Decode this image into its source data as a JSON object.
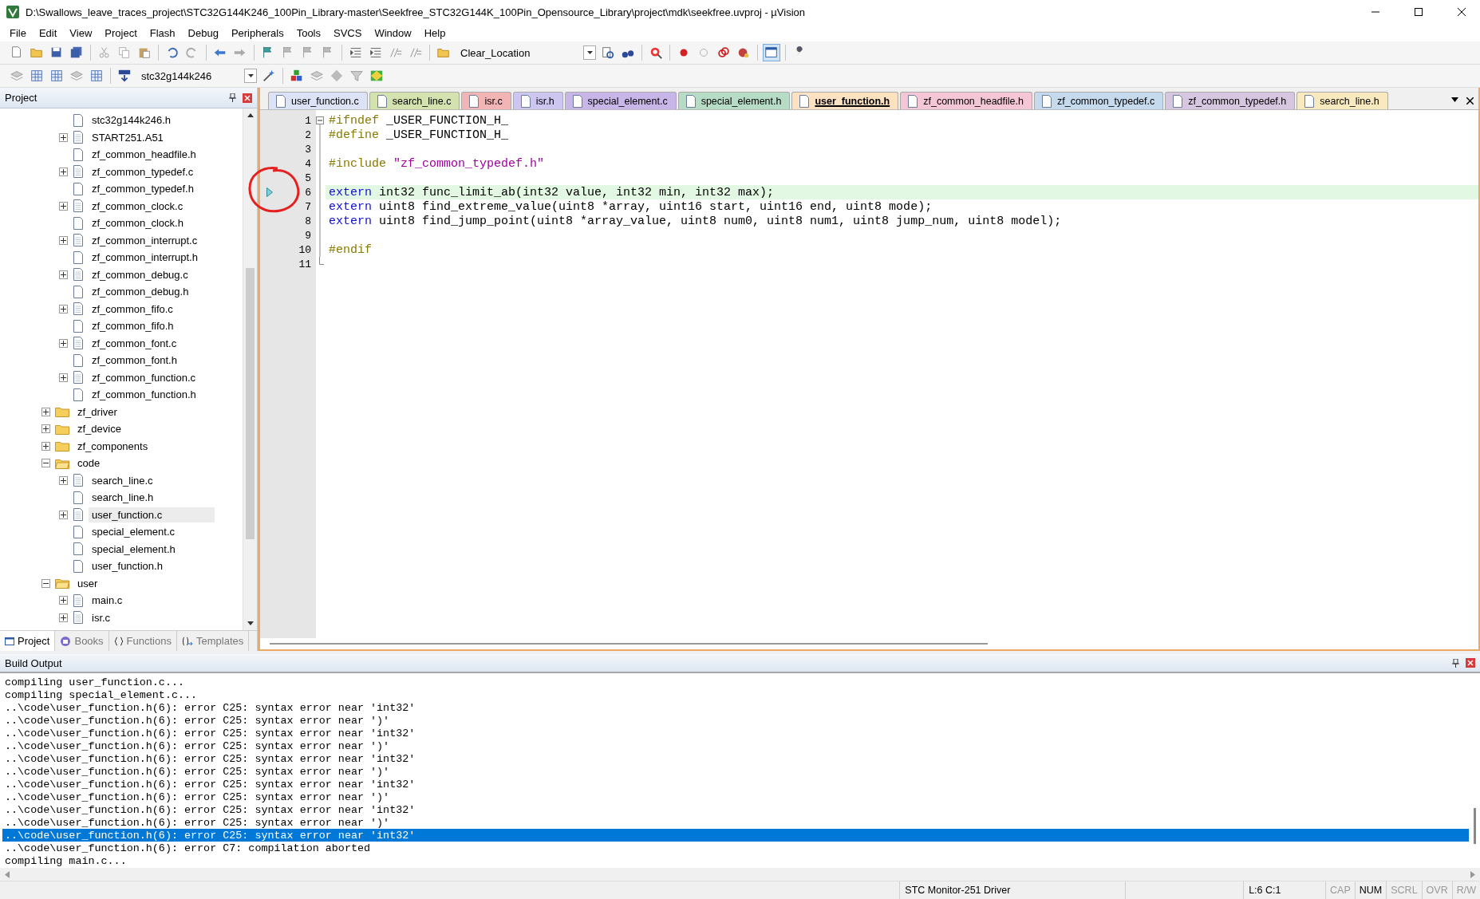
{
  "window": {
    "title": "D:\\Swallows_leave_traces_project\\STC32G144K246_100Pin_Library-master\\Seekfree_STC32G144K_100Pin_Opensource_Library\\project\\mdk\\seekfree.uvproj - µVision"
  },
  "menu": [
    "File",
    "Edit",
    "View",
    "Project",
    "Flash",
    "Debug",
    "Peripherals",
    "Tools",
    "SVCS",
    "Window",
    "Help"
  ],
  "toolbar": {
    "find_combo": "Clear_Location",
    "target_combo": "stc32g144k246"
  },
  "project_panel": {
    "title": "Project",
    "tree": {
      "nested_files": [
        {
          "label": "stc32g144k246.h",
          "expandable": false,
          "selected": false
        },
        {
          "label": "START251.A51",
          "expandable": true,
          "selected": false
        },
        {
          "label": "zf_common_headfile.h",
          "expandable": false,
          "selected": false
        },
        {
          "label": "zf_common_typedef.c",
          "expandable": true,
          "selected": false
        },
        {
          "label": "zf_common_typedef.h",
          "expandable": false,
          "selected": false
        },
        {
          "label": "zf_common_clock.c",
          "expandable": true,
          "selected": false
        },
        {
          "label": "zf_common_clock.h",
          "expandable": false,
          "selected": false
        },
        {
          "label": "zf_common_interrupt.c",
          "expandable": true,
          "selected": false
        },
        {
          "label": "zf_common_interrupt.h",
          "expandable": false,
          "selected": false
        },
        {
          "label": "zf_common_debug.c",
          "expandable": true,
          "selected": false
        },
        {
          "label": "zf_common_debug.h",
          "expandable": false,
          "selected": false
        },
        {
          "label": "zf_common_fifo.c",
          "expandable": true,
          "selected": false
        },
        {
          "label": "zf_common_fifo.h",
          "expandable": false,
          "selected": false
        },
        {
          "label": "zf_common_font.c",
          "expandable": true,
          "selected": false
        },
        {
          "label": "zf_common_font.h",
          "expandable": false,
          "selected": false
        },
        {
          "label": "zf_common_function.c",
          "expandable": true,
          "selected": false
        },
        {
          "label": "zf_common_function.h",
          "expandable": false,
          "selected": false
        }
      ],
      "items": [
        {
          "label": "zf_driver",
          "expandable": true,
          "expanded": false,
          "selected": false
        },
        {
          "label": "zf_device",
          "expandable": true,
          "expanded": false,
          "selected": false
        },
        {
          "label": "zf_components",
          "expandable": true,
          "expanded": false,
          "selected": false
        },
        {
          "label": "code",
          "expandable": true,
          "expanded": true,
          "selected": false,
          "children": [
            {
              "label": "search_line.c",
              "expandable": true,
              "selected": false
            },
            {
              "label": "search_line.h",
              "expandable": false,
              "selected": false
            },
            {
              "label": "user_function.c",
              "expandable": true,
              "selected": true
            },
            {
              "label": "special_element.c",
              "expandable": false,
              "selected": false
            },
            {
              "label": "special_element.h",
              "expandable": false,
              "selected": false
            },
            {
              "label": "user_function.h",
              "expandable": false,
              "selected": false
            }
          ]
        },
        {
          "label": "user",
          "expandable": true,
          "expanded": true,
          "selected": false,
          "children": [
            {
              "label": "main.c",
              "expandable": true,
              "selected": false
            },
            {
              "label": "isr.c",
              "expandable": true,
              "selected": false
            }
          ]
        }
      ]
    },
    "tabs": [
      {
        "label": "Project",
        "selected": true
      },
      {
        "label": "Books",
        "selected": false
      },
      {
        "label": "Functions",
        "selected": false
      },
      {
        "label": "Templates",
        "selected": false
      }
    ]
  },
  "editor": {
    "tabs": [
      {
        "label": "user_function.c",
        "color": "#dde3f6",
        "selected": false
      },
      {
        "label": "search_line.c",
        "color": "#d4e2b0",
        "selected": false
      },
      {
        "label": "isr.c",
        "color": "#f2b4b4",
        "selected": false
      },
      {
        "label": "isr.h",
        "color": "#cdc6f0",
        "selected": false
      },
      {
        "label": "special_element.c",
        "color": "#c9b6e8",
        "selected": false
      },
      {
        "label": "special_element.h",
        "color": "#b6dcc6",
        "selected": false
      },
      {
        "label": "user_function.h",
        "color": "#fde2c2",
        "selected": true
      },
      {
        "label": "zf_common_headfile.h",
        "color": "#f4c6d6",
        "selected": false
      },
      {
        "label": "zf_common_typedef.c",
        "color": "#c6daee",
        "selected": false
      },
      {
        "label": "zf_common_typedef.h",
        "color": "#d6c6e0",
        "selected": false
      },
      {
        "label": "search_line.h",
        "color": "#f8eabe",
        "selected": false
      }
    ],
    "lines": [
      {
        "number": "1",
        "current": false,
        "tokens": [
          {
            "kind": "preproc",
            "text": "#ifndef"
          },
          {
            "kind": "plain",
            "text": " _USER_FUNCTION_H_"
          }
        ]
      },
      {
        "number": "2",
        "current": false,
        "tokens": [
          {
            "kind": "preproc",
            "text": "#define"
          },
          {
            "kind": "plain",
            "text": " _USER_FUNCTION_H_"
          }
        ]
      },
      {
        "number": "3",
        "current": false
      },
      {
        "number": "4",
        "current": false,
        "tokens": [
          {
            "kind": "preproc",
            "text": "#include"
          },
          {
            "kind": "string",
            "text": " \"zf_common_typedef.h\""
          }
        ]
      },
      {
        "number": "5",
        "current": false
      },
      {
        "number": "6",
        "current": true,
        "tokens": [
          {
            "kind": "keyword",
            "text": "extern"
          },
          {
            "kind": "plain",
            "text": " int32 func_limit_ab(int32 value, int32 min, int32 max);"
          }
        ]
      },
      {
        "number": "7",
        "current": false,
        "tokens": [
          {
            "kind": "keyword",
            "text": "extern"
          },
          {
            "kind": "plain",
            "text": " uint8 find_extreme_value(uint8 *array, uint16 start, uint16 end, uint8 mode);"
          }
        ]
      },
      {
        "number": "8",
        "current": false,
        "tokens": [
          {
            "kind": "keyword",
            "text": "extern"
          },
          {
            "kind": "plain",
            "text": " uint8 find_jump_point(uint8 *array_value, uint8 num0, uint8 num1, uint8 jump_num, uint8 model);"
          }
        ]
      },
      {
        "number": "9",
        "current": false
      },
      {
        "number": "10",
        "current": false,
        "tokens": [
          {
            "kind": "preproc",
            "text": "#endif"
          }
        ]
      },
      {
        "number": "11",
        "current": false
      }
    ],
    "fold_block": {
      "collapsed": false
    }
  },
  "build_output": {
    "title": "Build Output",
    "lines": [
      {
        "text": "compiling user_function.c...",
        "selected": false
      },
      {
        "text": "compiling special_element.c...",
        "selected": false
      },
      {
        "text": "..\\code\\user_function.h(6): error C25: syntax error near 'int32'",
        "selected": false
      },
      {
        "text": "..\\code\\user_function.h(6): error C25: syntax error near ')'",
        "selected": false
      },
      {
        "text": "..\\code\\user_function.h(6): error C25: syntax error near 'int32'",
        "selected": false
      },
      {
        "text": "..\\code\\user_function.h(6): error C25: syntax error near ')'",
        "selected": false
      },
      {
        "text": "..\\code\\user_function.h(6): error C25: syntax error near 'int32'",
        "selected": false
      },
      {
        "text": "..\\code\\user_function.h(6): error C25: syntax error near ')'",
        "selected": false
      },
      {
        "text": "..\\code\\user_function.h(6): error C25: syntax error near 'int32'",
        "selected": false
      },
      {
        "text": "..\\code\\user_function.h(6): error C25: syntax error near ')'",
        "selected": false
      },
      {
        "text": "..\\code\\user_function.h(6): error C25: syntax error near 'int32'",
        "selected": false
      },
      {
        "text": "..\\code\\user_function.h(6): error C25: syntax error near ')'",
        "selected": false
      },
      {
        "text": "..\\code\\user_function.h(6): error C25: syntax error near 'int32'",
        "selected": true
      },
      {
        "text": "..\\code\\user_function.h(6): error C7: compilation aborted",
        "selected": false
      },
      {
        "text": "compiling main.c...",
        "selected": false
      }
    ]
  },
  "status_bar": {
    "driver": "STC Monitor-251 Driver",
    "position": "L:6 C:1",
    "indicators": [
      {
        "label": "CAP",
        "on": false
      },
      {
        "label": "NUM",
        "on": true
      },
      {
        "label": "SCRL",
        "on": false
      },
      {
        "label": "OVR",
        "on": false
      },
      {
        "label": "R/W",
        "on": false
      }
    ]
  }
}
